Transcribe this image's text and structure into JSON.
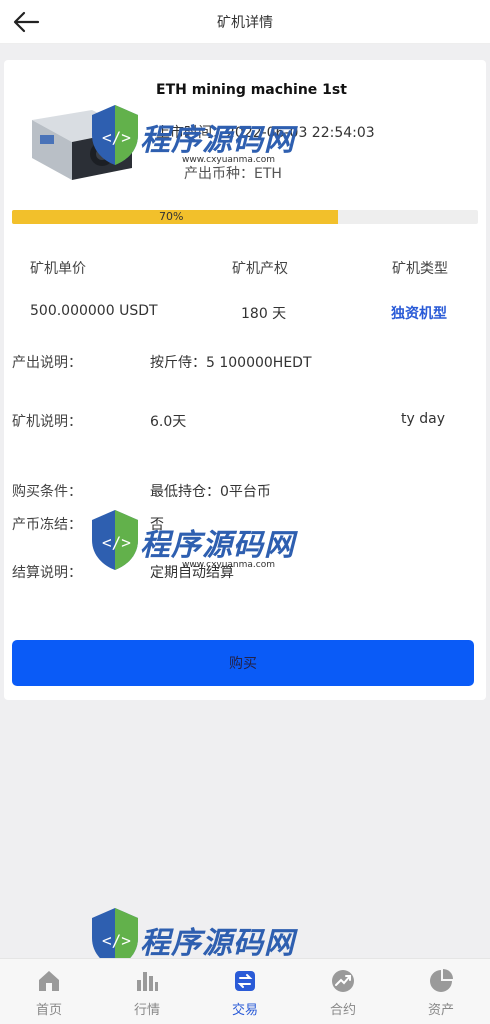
{
  "header": {
    "title": "矿机详情",
    "back_icon": "arrow-left-icon"
  },
  "machine": {
    "name": "ETH mining machine 1st",
    "time_label": "上市时间：",
    "time_value": "2022-06-03 22:54:03",
    "coin_label": "产出币种：",
    "coin_value": "ETH",
    "progress_percent": 70,
    "progress_label": "70%"
  },
  "stats": {
    "headers": [
      "矿机单价",
      "矿机产权",
      "矿机类型"
    ],
    "values": [
      "500.000000 USDT",
      "180 天",
      "独资机型"
    ]
  },
  "info": [
    {
      "label": "产出说明：",
      "value": "按斤侍：5 100000HEDT",
      "extra": ""
    },
    {
      "label": "矿机说明：",
      "value": "6.0天",
      "extra": "ty day"
    },
    {
      "label": "购买条件：",
      "value": "最低持仓：0平台币",
      "extra": ""
    },
    {
      "label": "产币冻结：",
      "value": "否",
      "extra": ""
    },
    {
      "label": "结算说明：",
      "value": "定期自动结算",
      "extra": ""
    }
  ],
  "buy_button": "购买",
  "watermark": {
    "text": "程序源码网",
    "url": "www.cxyuanma.com"
  },
  "tabs": [
    {
      "label": "首页",
      "icon": "home-icon"
    },
    {
      "label": "行情",
      "icon": "bar-chart-icon"
    },
    {
      "label": "交易",
      "icon": "exchange-icon",
      "active": true
    },
    {
      "label": "合约",
      "icon": "trend-icon"
    },
    {
      "label": "资产",
      "icon": "pie-chart-icon"
    }
  ],
  "colors": {
    "accent": "#0a5bf7",
    "progress": "#f2c02b",
    "link": "#2a5bd7"
  }
}
